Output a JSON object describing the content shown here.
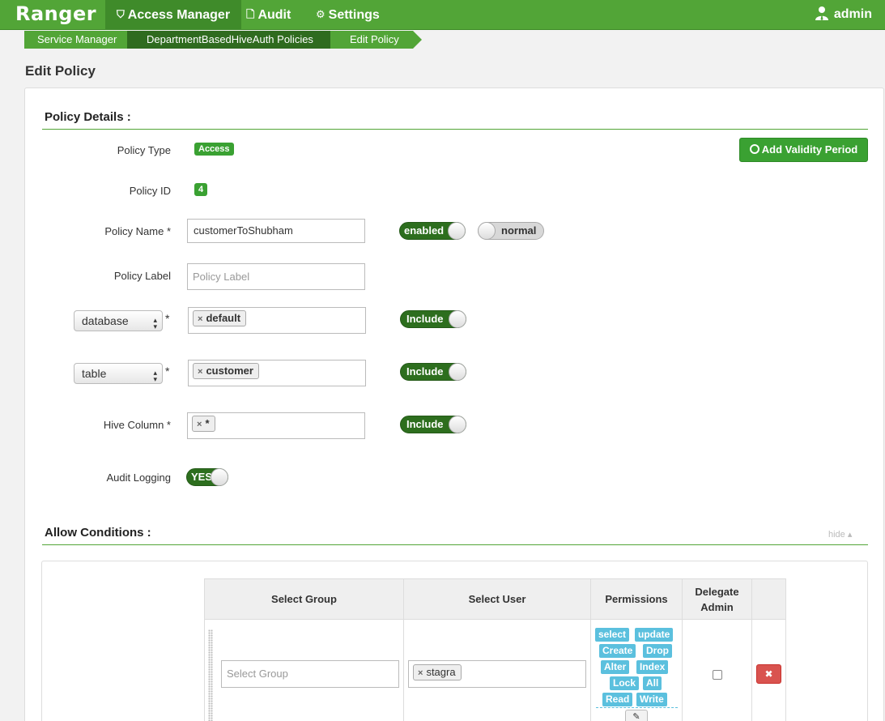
{
  "nav": {
    "brand": "Ranger",
    "items": [
      {
        "label": "Access Manager",
        "icon": "shield-icon"
      },
      {
        "label": "Audit",
        "icon": "file-icon"
      },
      {
        "label": "Settings",
        "icon": "gear-icon"
      }
    ],
    "user": "admin"
  },
  "breadcrumb": [
    "Service Manager",
    "DepartmentBasedHiveAuth Policies",
    "Edit Policy"
  ],
  "page_title": "Edit Policy",
  "details": {
    "section_title": "Policy Details :",
    "policy_type_label": "Policy Type",
    "policy_type": "Access",
    "add_validity_label": "Add Validity Period",
    "policy_id_label": "Policy ID",
    "policy_id": "4",
    "policy_name_label": "Policy Name *",
    "policy_name": "customerToShubham",
    "enabled_label": "enabled",
    "normal_label": "normal",
    "policy_label_label": "Policy Label",
    "policy_label_placeholder": "Policy Label",
    "resources": [
      {
        "type": "database",
        "value": "default",
        "toggle": "Include"
      },
      {
        "type": "table",
        "value": "customer",
        "toggle": "Include"
      }
    ],
    "hive_column_label": "Hive Column *",
    "hive_column_value": "*",
    "hive_column_toggle": "Include",
    "audit_logging_label": "Audit Logging",
    "audit_logging_value": "YES"
  },
  "allow": {
    "section_title": "Allow Conditions :",
    "hide_label": "hide ▴",
    "columns": [
      "Select Group",
      "Select User",
      "Permissions",
      "Delegate Admin",
      ""
    ],
    "group_placeholder": "Select Group",
    "user_tag": "stagra",
    "permissions": [
      "select",
      "update",
      "Create",
      "Drop",
      "Alter",
      "Index",
      "Lock",
      "All",
      "Read",
      "Write"
    ]
  },
  "colors": {
    "nav": "#52a537",
    "accent": "#3aa132",
    "perm": "#5bc0de",
    "danger": "#d9534f"
  }
}
